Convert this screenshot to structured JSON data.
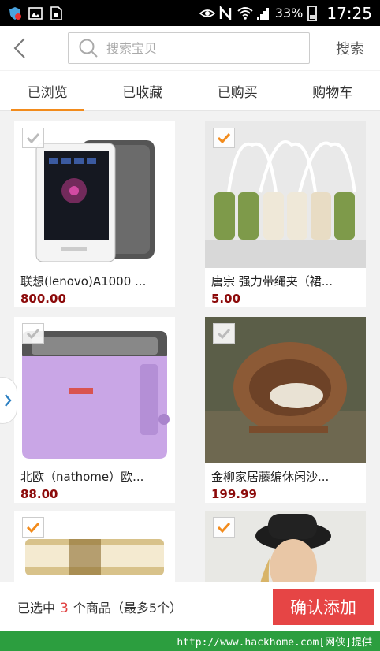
{
  "status_bar": {
    "battery_percent": "33%",
    "time": "17:25"
  },
  "header": {
    "search_placeholder": "搜索宝贝",
    "search_button": "搜索"
  },
  "tabs": [
    {
      "label": "已浏览",
      "active": true
    },
    {
      "label": "已收藏",
      "active": false
    },
    {
      "label": "已购买",
      "active": false
    },
    {
      "label": "购物车",
      "active": false
    }
  ],
  "products": [
    {
      "name": "联想(lenovo)A1000 ...",
      "price": "800.00",
      "selected": false
    },
    {
      "name": "唐宗 强力带绳夹（裙...",
      "price": "5.00",
      "selected": true
    },
    {
      "name": "北欧（nathome）欧...",
      "price": "88.00",
      "selected": false
    },
    {
      "name": "金柳家居藤编休闲沙...",
      "price": "199.99",
      "selected": false
    },
    {
      "name": "",
      "price": "",
      "selected": true
    },
    {
      "name": "",
      "price": "",
      "selected": true
    }
  ],
  "bottom_bar": {
    "prefix": "已选中",
    "count": "3",
    "suffix": "个商品（最多5个）",
    "confirm_button": "确认添加"
  },
  "watermark": "http://www.hackhome.com[网侠]提供",
  "colors": {
    "accent_orange": "#f28b1c",
    "price_red": "#8c0a0a",
    "confirm_red": "#e64545",
    "watermark_green": "#2c9e3f"
  }
}
